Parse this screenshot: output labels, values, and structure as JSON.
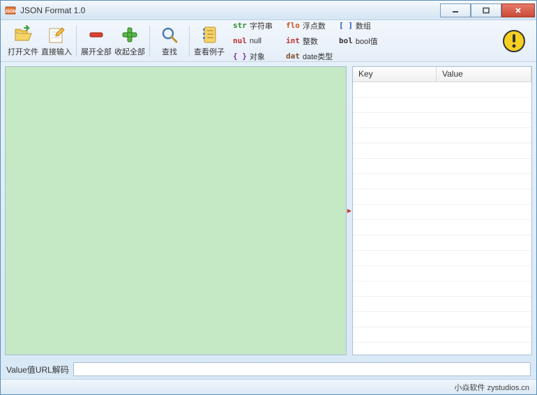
{
  "window": {
    "title": "JSON Format 1.0"
  },
  "toolbar": {
    "open_file": "打开文件",
    "direct_input": "直接输入",
    "expand_all": "展开全部",
    "collapse_all": "收起全部",
    "find": "查找",
    "view_examples": "查看例子"
  },
  "legend": {
    "str_key": "str",
    "str_label": "字符串",
    "flo_key": "flo",
    "flo_label": "浮点数",
    "arr_key": "[ ]",
    "arr_label": "数组",
    "nul_key": "nul",
    "nul_label": "null",
    "int_key": "int",
    "int_label": "整数",
    "bol_key": "bol",
    "bol_label": "bool值",
    "obj_key": "{ }",
    "obj_label": "对象",
    "dat_key": "dat",
    "dat_label": "date类型"
  },
  "table": {
    "key_header": "Key",
    "value_header": "Value"
  },
  "bottom": {
    "label": "Value值URL解码",
    "value": ""
  },
  "status": {
    "text": "小焱软件 zystudios.cn"
  }
}
